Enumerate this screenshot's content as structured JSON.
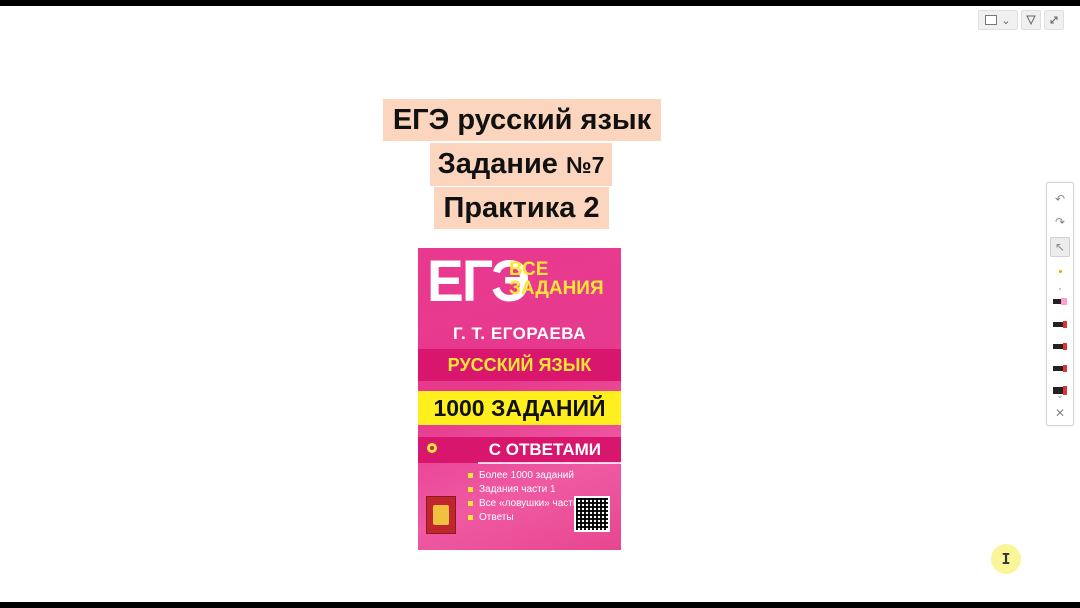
{
  "title": {
    "line1": "ЕГЭ русский язык",
    "line2_main": "Задание ",
    "line2_small": "№7",
    "line3": "Практика 2"
  },
  "book_cover": {
    "brand": "ЕГЭ",
    "series": "ВСЕ ЗАДАНИЯ",
    "author": "Г. Т. ЕГОРАЕВА",
    "subject": "РУССКИЙ ЯЗЫК",
    "count": "1000 ЗАДАНИЙ",
    "answers": "С ОТВЕТАМИ",
    "bullets": [
      "Более 1000 заданий",
      "Задания части 1",
      "Все «ловушки» части 1",
      "Ответы"
    ],
    "colors": {
      "background": "#e63a8e",
      "band": "#d8166e",
      "count_band": "#ffef1e",
      "accent": "#ffe733"
    }
  },
  "view_controls": {
    "layout_icon": "layout-rect-icon",
    "dropdown_icon": "chevron-down-icon",
    "filter_icon": "funnel-icon",
    "expand_icon": "expand-icon"
  },
  "toolbar": {
    "items": [
      "undo-icon",
      "redo-icon",
      "pointer-icon",
      "yellow-dot-icon",
      "small-dot-icon",
      "highlighter-icon",
      "marker-red-icon",
      "marker-red-icon",
      "marker-red-icon",
      "marker-red-large-icon",
      "chevron-down-icon",
      "close-icon"
    ],
    "undo": "↶",
    "redo": "↷",
    "pointer": "↖",
    "more": "⌄",
    "close": "✕"
  },
  "cursor": {
    "glyph": "I"
  }
}
